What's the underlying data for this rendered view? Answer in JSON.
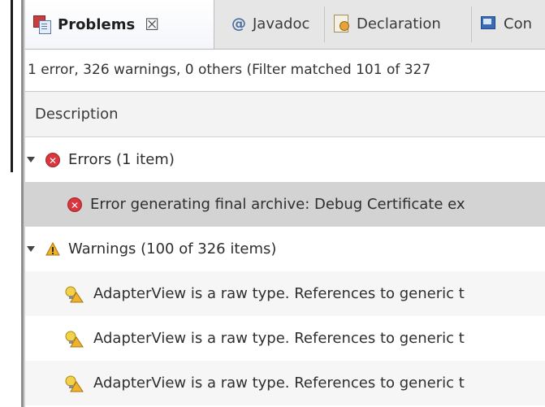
{
  "tabs": [
    {
      "label": "Problems",
      "icon": "problems-icon",
      "active": true
    },
    {
      "label": "Javadoc",
      "icon": "at-icon"
    },
    {
      "label": "Declaration",
      "icon": "declaration-icon"
    },
    {
      "label": "Con",
      "icon": "console-icon"
    }
  ],
  "close_glyph": "☒",
  "status_text": "1 error, 326 warnings, 0 others (Filter matched 101 of 327",
  "column_header": "Description",
  "groups": {
    "errors": {
      "label": "Errors (1 item)",
      "items": [
        "Error generating final archive: Debug Certificate ex"
      ]
    },
    "warnings": {
      "label": "Warnings (100 of 326 items)",
      "items": [
        "AdapterView is a raw type. References to generic t",
        "AdapterView is a raw type. References to generic t",
        "AdapterView is a raw type. References to generic t"
      ]
    }
  },
  "colors": {
    "error": "#d9363e",
    "warning": "#e0a21a",
    "selection": "#d3d3d3"
  }
}
